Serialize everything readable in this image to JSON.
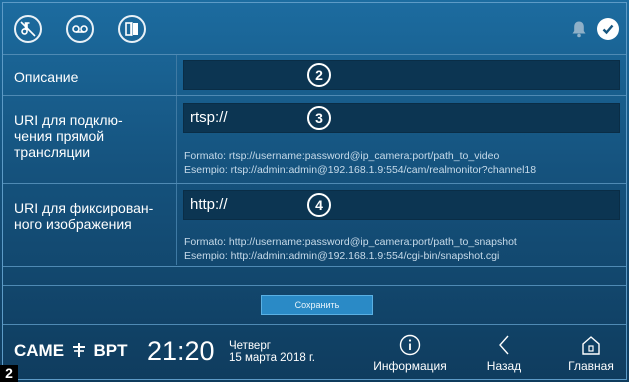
{
  "topbar": {
    "icons": [
      "mute-ringtone-icon",
      "answering-machine-icon",
      "door-status-icon"
    ],
    "right_icons": [
      "bell-icon",
      "check-icon"
    ]
  },
  "form": {
    "description": {
      "label": "Описание",
      "value": "",
      "marker": "2"
    },
    "stream_uri": {
      "label": "URI для подклю-\nчения прямой\nтрансляции",
      "value": "rtsp://",
      "marker": "3",
      "format": "Formato: rtsp://username:password@ip_camera:port/path_to_video",
      "example": "Esempio: rtsp://admin:admin@192.168.1.9:554/cam/realmonitor?channel18"
    },
    "snapshot_uri": {
      "label": "URI для фиксирован-\nного изображения",
      "value": "http://",
      "marker": "4",
      "format": "Formato: http://username:password@ip_camera:port/path_to_snapshot",
      "example": "Esempio: http://admin:admin@192.168.1.9:554/cgi-bin/snapshot.cgi"
    },
    "save_label": "Сохранить"
  },
  "footer": {
    "brand_came": "CAME",
    "brand_bpt": "BPT",
    "time": "21:20",
    "weekday": "Четверг",
    "date": "15 марта 2018 г.",
    "nav": [
      {
        "label": "Информация",
        "icon": "info-icon"
      },
      {
        "label": "Назад",
        "icon": "chevron-left-icon"
      },
      {
        "label": "Главная",
        "icon": "home-icon"
      }
    ]
  },
  "figure_number": "2"
}
